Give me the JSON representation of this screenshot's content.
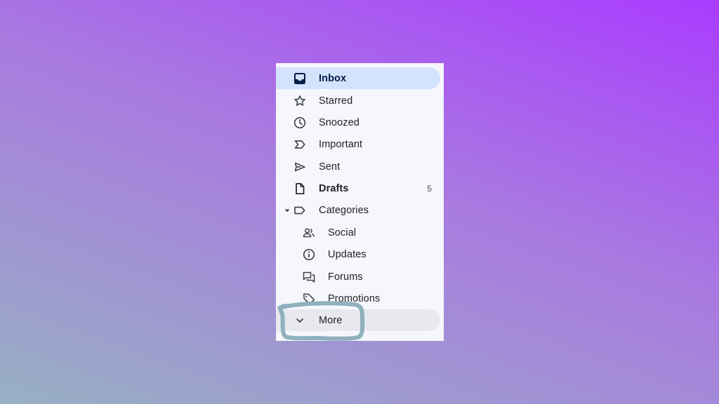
{
  "sidebar": {
    "items": [
      {
        "label": "Inbox",
        "icon": "inbox-icon"
      },
      {
        "label": "Starred",
        "icon": "star-icon"
      },
      {
        "label": "Snoozed",
        "icon": "clock-icon"
      },
      {
        "label": "Important",
        "icon": "important-icon"
      },
      {
        "label": "Sent",
        "icon": "send-icon"
      },
      {
        "label": "Drafts",
        "icon": "draft-icon",
        "count": "5"
      },
      {
        "label": "Categories",
        "icon": "label-icon"
      }
    ],
    "categories": [
      {
        "label": "Social",
        "icon": "people-icon"
      },
      {
        "label": "Updates",
        "icon": "info-icon"
      },
      {
        "label": "Forums",
        "icon": "forum-icon"
      },
      {
        "label": "Promotions",
        "icon": "tag-icon"
      }
    ],
    "more_label": "More"
  },
  "colors": {
    "active_background": "#d3e3fd",
    "panel_background": "#f5f7fc",
    "annotation_stroke": "#8fb0bd"
  }
}
